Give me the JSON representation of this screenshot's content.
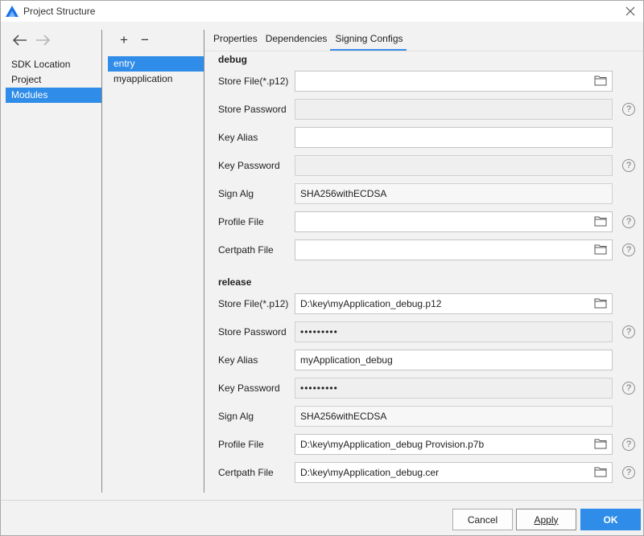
{
  "window": {
    "title": "Project Structure"
  },
  "nav": {
    "items": [
      {
        "label": "SDK Location",
        "selected": false
      },
      {
        "label": "Project",
        "selected": false
      },
      {
        "label": "Modules",
        "selected": true
      }
    ]
  },
  "modules": {
    "add_icon": "+",
    "remove_icon": "−",
    "items": [
      {
        "label": "entry",
        "selected": true
      },
      {
        "label": "myapplication",
        "selected": false
      }
    ]
  },
  "tabs": [
    {
      "label": "Properties",
      "active": false
    },
    {
      "label": "Dependencies",
      "active": false
    },
    {
      "label": "Signing Configs",
      "active": true
    }
  ],
  "debug": {
    "title": "debug",
    "store_file_label": "Store File(*.p12)",
    "store_file_value": "",
    "store_password_label": "Store Password",
    "store_password_value": "",
    "key_alias_label": "Key Alias",
    "key_alias_value": "",
    "key_password_label": "Key Password",
    "key_password_value": "",
    "sign_alg_label": "Sign Alg",
    "sign_alg_value": "SHA256withECDSA",
    "profile_file_label": "Profile File",
    "profile_file_value": "",
    "certpath_file_label": "Certpath File",
    "certpath_file_value": ""
  },
  "release": {
    "title": "release",
    "store_file_label": "Store File(*.p12)",
    "store_file_value": "D:\\key\\myApplication_debug.p12",
    "store_password_label": "Store Password",
    "store_password_value": "•••••••••",
    "key_alias_label": "Key Alias",
    "key_alias_value": "myApplication_debug",
    "key_password_label": "Key Password",
    "key_password_value": "•••••••••",
    "sign_alg_label": "Sign Alg",
    "sign_alg_value": "SHA256withECDSA",
    "profile_file_label": "Profile File",
    "profile_file_value": "D:\\key\\myApplication_debug Provision.p7b",
    "certpath_file_label": "Certpath File",
    "certpath_file_value": "D:\\key\\myApplication_debug.cer"
  },
  "help_icon": "?",
  "buttons": {
    "cancel": "Cancel",
    "apply": "Apply",
    "ok": "OK"
  },
  "colors": {
    "accent": "#2f8ce8"
  }
}
